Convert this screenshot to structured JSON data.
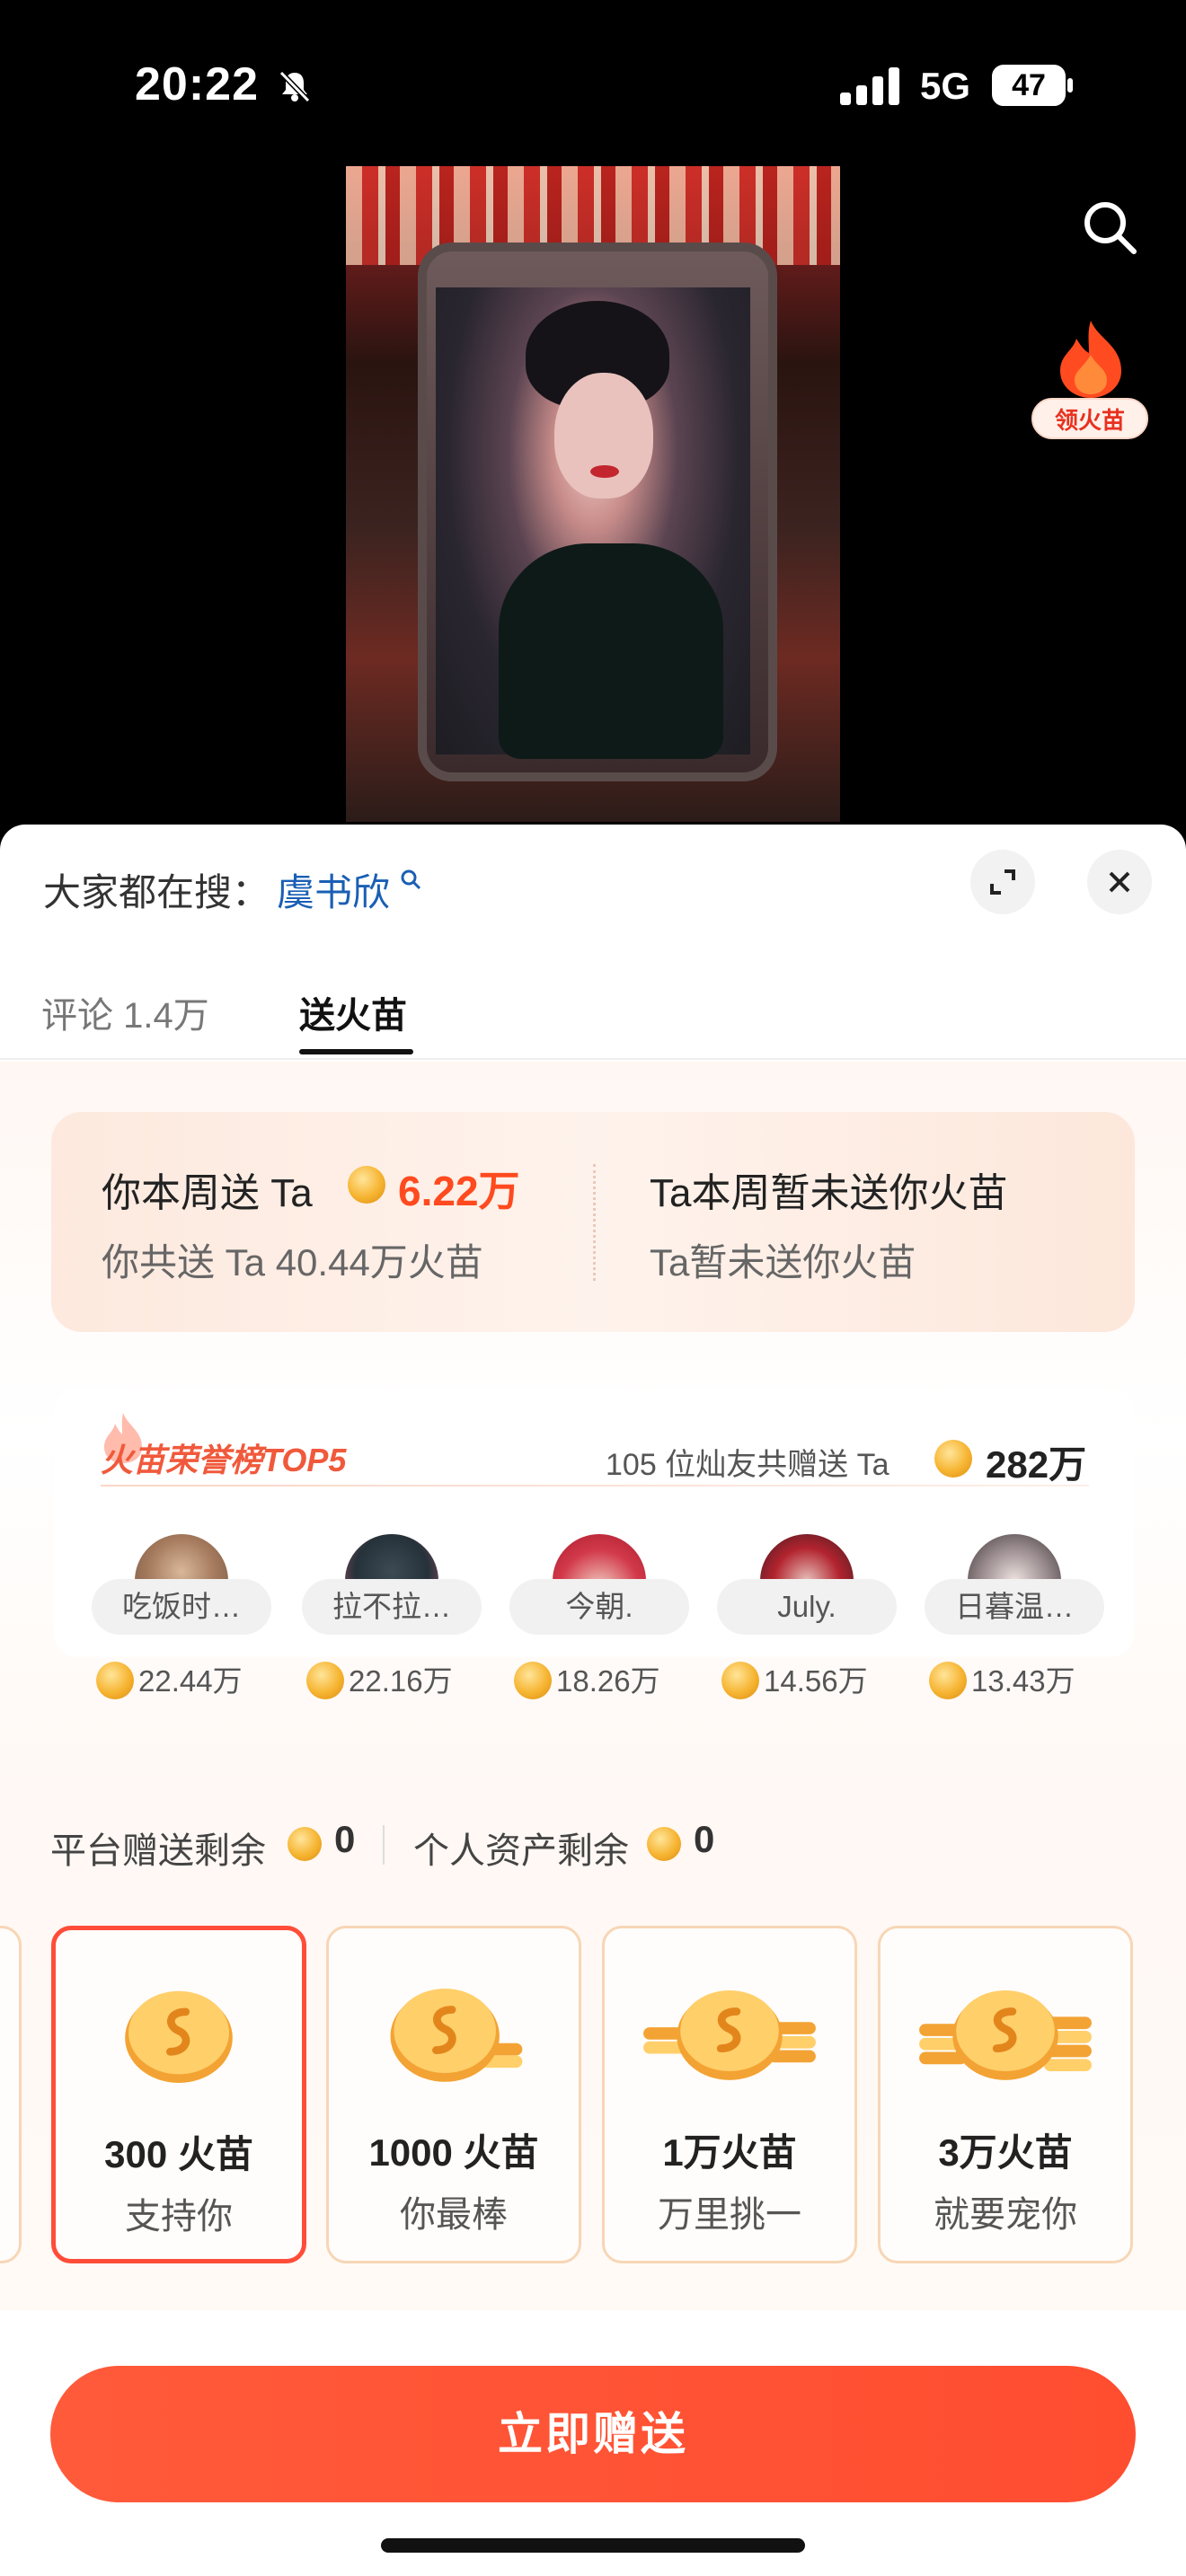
{
  "status_bar": {
    "time": "20:22",
    "network": "5G",
    "battery": "47"
  },
  "video": {
    "fire_widget_label": "领火苗"
  },
  "sheet": {
    "search_prefix": "大家都在搜：",
    "search_term": "虞书欣",
    "tabs": [
      {
        "label": "评论 1.4万",
        "active": false
      },
      {
        "label": "送火苗",
        "active": true
      }
    ],
    "weekly": {
      "you_sent_prefix": "你本周送 Ta",
      "you_sent_amount": "6.22万",
      "you_total": "你共送 Ta 40.44万火苗",
      "ta_week": "Ta本周暂未送你火苗",
      "ta_total": "Ta暂未送你火苗"
    },
    "honor": {
      "title": "火苗荣誉榜TOP5",
      "summary": "105 位灿友共赠送 Ta",
      "summary_amount": "282万",
      "fans": [
        {
          "name": "吃饭时…",
          "amount": "22.44万"
        },
        {
          "name": "拉不拉…",
          "amount": "22.16万"
        },
        {
          "name": "今朝.",
          "amount": "18.26万"
        },
        {
          "name": "July.",
          "amount": "14.56万"
        },
        {
          "name": "日暮温…",
          "amount": "13.43万"
        }
      ]
    },
    "balance": {
      "platform_label": "平台赠送剩余",
      "platform_value": "0",
      "personal_label": "个人资产剩余",
      "personal_value": "0"
    },
    "gifts": [
      {
        "amount": "300 火苗",
        "sub": "支持你",
        "selected": true
      },
      {
        "amount": "1000 火苗",
        "sub": "你最棒",
        "selected": false
      },
      {
        "amount": "1万火苗",
        "sub": "万里挑一",
        "selected": false
      },
      {
        "amount": "3万火苗",
        "sub": "就要宠你",
        "selected": false
      }
    ],
    "send_button": "立即赠送"
  },
  "colors": {
    "accent": "#ff4d30",
    "link": "#1a5fb4",
    "coin": "#f6b431"
  }
}
